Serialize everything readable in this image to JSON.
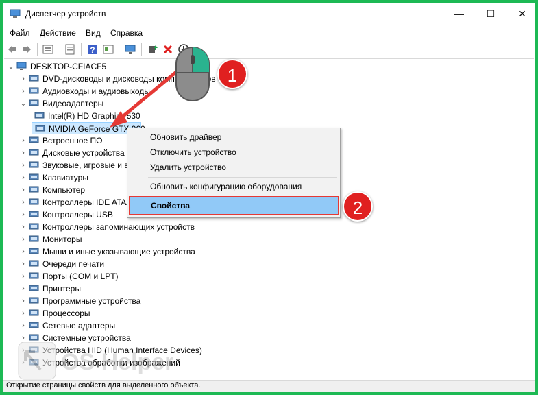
{
  "window": {
    "title": "Диспетчер устройств",
    "controls": {
      "minimize": "—",
      "maximize": "☐",
      "close": "✕"
    }
  },
  "menu": [
    "Файл",
    "Действие",
    "Вид",
    "Справка"
  ],
  "toolbar_icons": [
    "back-arrow-icon",
    "forward-arrow-icon",
    "properties-icon",
    "device-list-icon",
    "help-icon",
    "details-icon",
    "monitor-icon",
    "update-driver-icon",
    "uninstall-icon",
    "download-icon"
  ],
  "tree": {
    "root": "DESKTOP-CFIACF5",
    "items": [
      {
        "label": "DVD-дисководы и дисководы компакт-дисков",
        "expanded": false
      },
      {
        "label": "Аудиовходы и аудиовыходы",
        "expanded": false
      },
      {
        "label": "Видеоадаптеры",
        "expanded": true
      },
      {
        "label": "Intel(R) HD Graphics 530",
        "child": true
      },
      {
        "label": "NVIDIA GeForce GTX 960",
        "child": true,
        "selected": true
      },
      {
        "label": "Встроенное ПО",
        "expanded": false
      },
      {
        "label": "Дисковые устройства",
        "expanded": false
      },
      {
        "label": "Звуковые, игровые и видеоустройства",
        "expanded": false
      },
      {
        "label": "Клавиатуры",
        "expanded": false
      },
      {
        "label": "Компьютер",
        "expanded": false
      },
      {
        "label": "Контроллеры IDE ATA/ATAPI",
        "expanded": false
      },
      {
        "label": "Контроллеры USB",
        "expanded": false
      },
      {
        "label": "Контроллеры запоминающих устройств",
        "expanded": false
      },
      {
        "label": "Мониторы",
        "expanded": false
      },
      {
        "label": "Мыши и иные указывающие устройства",
        "expanded": false
      },
      {
        "label": "Очереди печати",
        "expanded": false
      },
      {
        "label": "Порты (COM и LPT)",
        "expanded": false
      },
      {
        "label": "Принтеры",
        "expanded": false
      },
      {
        "label": "Программные устройства",
        "expanded": false
      },
      {
        "label": "Процессоры",
        "expanded": false
      },
      {
        "label": "Сетевые адаптеры",
        "expanded": false
      },
      {
        "label": "Системные устройства",
        "expanded": false
      },
      {
        "label": "Устройства HID (Human Interface Devices)",
        "expanded": false
      },
      {
        "label": "Устройства обработки изображений",
        "expanded": false
      }
    ]
  },
  "context_menu": {
    "items": [
      "Обновить драйвер",
      "Отключить устройство",
      "Удалить устройство",
      "Обновить конфигурацию оборудования",
      "Свойства"
    ]
  },
  "annotations": {
    "step1": "1",
    "step2": "2"
  },
  "watermark": "OS Helper",
  "status": "Открытие страницы свойств для выделенного объекта.",
  "colors": {
    "frame": "#1db954",
    "accent_red": "#e02020",
    "selection": "#91c9f7",
    "mouse_green": "#2ab38f"
  }
}
